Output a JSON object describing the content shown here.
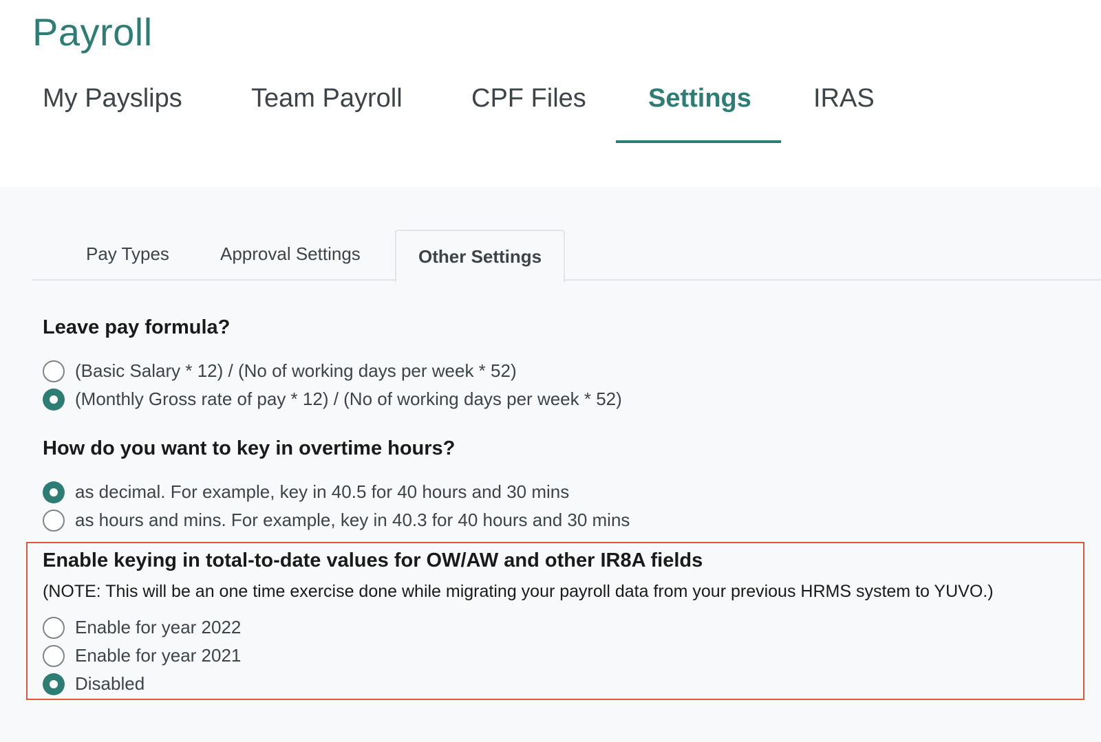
{
  "app": {
    "title": "Payroll"
  },
  "main_tabs": [
    {
      "label": "My Payslips"
    },
    {
      "label": "Team Payroll"
    },
    {
      "label": "CPF Files"
    },
    {
      "label": "Settings"
    },
    {
      "label": "IRAS"
    }
  ],
  "main_tab_active": "Settings",
  "sub_tabs": [
    {
      "label": "Pay Types"
    },
    {
      "label": "Approval Settings"
    },
    {
      "label": "Other Settings"
    }
  ],
  "sub_tab_active": "Other Settings",
  "leave_pay": {
    "title": "Leave pay formula?",
    "options": [
      {
        "label": "(Basic Salary * 12) / (No of working days per week * 52)",
        "selected": false
      },
      {
        "label": "(Monthly Gross rate of pay * 12) / (No of working days per week * 52)",
        "selected": true
      }
    ]
  },
  "overtime": {
    "title": "How do you want to key in overtime hours?",
    "options": [
      {
        "label": "as decimal. For example, key in 40.5 for 40 hours and 30 mins",
        "selected": true
      },
      {
        "label": "as hours and mins. For example, key in 40.3 for 40 hours and 30 mins",
        "selected": false
      }
    ]
  },
  "total_to_date": {
    "title": "Enable keying in total-to-date values for OW/AW and other IR8A fields",
    "note": "(NOTE: This will be an one time exercise done while migrating your payroll data from your previous HRMS system to YUVO.)",
    "options": [
      {
        "label": "Enable for year 2022",
        "selected": false
      },
      {
        "label": "Enable for year 2021",
        "selected": false
      },
      {
        "label": "Disabled",
        "selected": true
      }
    ]
  },
  "colors": {
    "accent": "#2e7d74",
    "highlight": "#e0553d"
  }
}
